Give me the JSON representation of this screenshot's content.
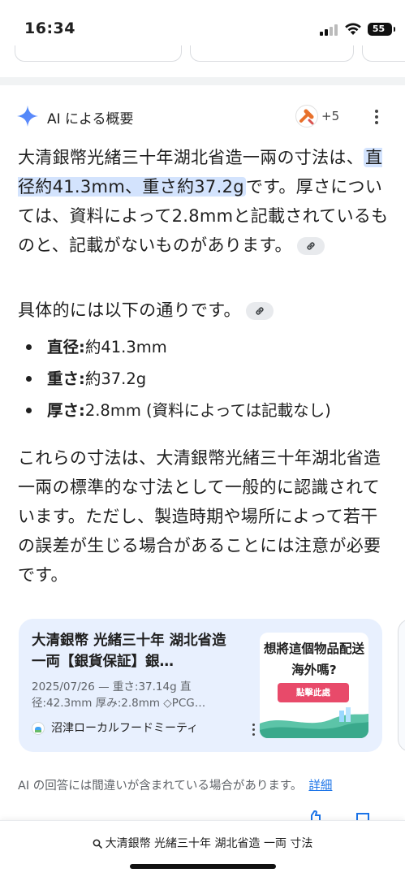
{
  "status_bar": {
    "time": "16:34",
    "battery": "55"
  },
  "ai_overview": {
    "title": "AI による概要",
    "source_count": "+5",
    "paragraph1_before": "大清銀幣光緒三十年湖北省造一兩の寸法は、",
    "paragraph1_highlight": "直径約41.3mm、重さ約37.2g",
    "paragraph1_after": "です。厚さについては、資料によって2.8mmと記載されているものと、記載がないものがあります。",
    "paragraph2": "具体的には以下の通りです。",
    "bullets": [
      {
        "label": "直径:",
        "value": "約41.3mm"
      },
      {
        "label": "重さ:",
        "value": "約37.2g"
      },
      {
        "label": "厚さ:",
        "value": "2.8mm (資料によっては記載なし)"
      }
    ],
    "paragraph3": "これらの寸法は、大清銀幣光緒三十年湖北省造一兩の標準的な寸法として一般的に認識されています。ただし、製造時期や場所によって若干の誤差が生じる場合があることには注意が必要です。"
  },
  "source_card": {
    "title": "大清銀幣 光緒三十年 湖北省造 一両【銀貨保証】銀…",
    "snippet": "2025/07/26 — 重さ:37.14g 直径:42.3mm 厚み:2.8mm ◇PCG…",
    "source_name": "沼津ローカルフードミーティ",
    "thumb_line1": "想將這個物品配送",
    "thumb_line2": "海外嗎?",
    "thumb_button": "點擊此處"
  },
  "disclaimer": {
    "text": "AI の回答には間違いが含まれている場合があります。",
    "link": "詳細"
  },
  "bottom_search": {
    "query": "大清銀幣 光緒三十年 湖北省造 一両 寸法"
  },
  "colors": {
    "highlight": "#d3e3fd",
    "card_bg": "#e8f0fe",
    "link": "#1a73e8",
    "sparkle": "#4285f4",
    "thumb_button": "#e84a6a"
  }
}
